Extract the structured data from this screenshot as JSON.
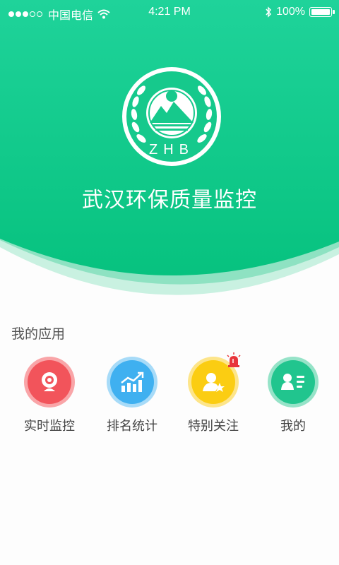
{
  "status_bar": {
    "carrier": "中国电信",
    "time": "4:21 PM",
    "battery": "100%",
    "battery_level": 1.0,
    "signal_bars_filled": 3,
    "signal_bars_total": 5
  },
  "header": {
    "logo_text": "ZHB",
    "title": "武汉环保质量监控"
  },
  "section": {
    "title": "我的应用"
  },
  "apps": [
    {
      "label": "实时监控",
      "icon": "camera-icon",
      "color": "#f2545b",
      "ring": "#f9a5a8"
    },
    {
      "label": "排名统计",
      "icon": "chart-trend-icon",
      "color": "#3fb0f0",
      "ring": "#a7dbf8"
    },
    {
      "label": "特别关注",
      "icon": "user-star-icon",
      "color": "#fbcd12",
      "ring": "#fde58a"
    },
    {
      "label": "我的",
      "icon": "profile-card-icon",
      "color": "#21c58e",
      "ring": "#96e3c8"
    }
  ],
  "colors": {
    "brand_green": "#1ccf8e",
    "brand_green_dark": "#0ebd80",
    "alarm_red": "#e8343a"
  }
}
